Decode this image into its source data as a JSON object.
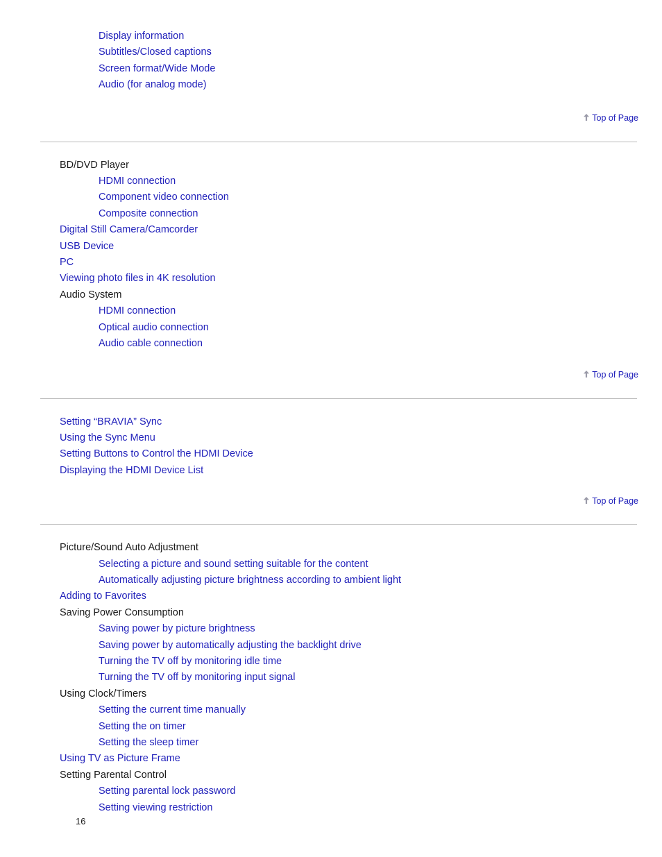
{
  "document": {
    "page_number": "16",
    "link_color": "#2222bb",
    "text_color": "#1a1a1a",
    "divider_color": "#b9b9b9"
  },
  "top_of_page": {
    "label": "Top of Page",
    "icon": "arrow-up-icon"
  },
  "sections": [
    {
      "id": "watching-tv",
      "has_divider_above": false,
      "items": [
        {
          "text": "Display information",
          "level": 2,
          "link": true
        },
        {
          "text": "Subtitles/Closed captions",
          "level": 2,
          "link": true
        },
        {
          "text": "Screen format/Wide Mode",
          "level": 2,
          "link": true
        },
        {
          "text": "Audio (for analog mode)",
          "level": 2,
          "link": true
        }
      ]
    },
    {
      "id": "connecting-devices",
      "has_divider_above": true,
      "items": [
        {
          "text": "BD/DVD Player",
          "level": 1,
          "link": false
        },
        {
          "text": "HDMI connection",
          "level": 2,
          "link": true
        },
        {
          "text": "Component video connection",
          "level": 2,
          "link": true
        },
        {
          "text": "Composite connection",
          "level": 2,
          "link": true
        },
        {
          "text": "Digital Still Camera/Camcorder",
          "level": 1,
          "link": true
        },
        {
          "text": "USB Device",
          "level": 1,
          "link": true
        },
        {
          "text": "PC",
          "level": 1,
          "link": true
        },
        {
          "text": "Viewing photo files in 4K resolution",
          "level": 1,
          "link": true
        },
        {
          "text": "Audio System",
          "level": 1,
          "link": false
        },
        {
          "text": "HDMI connection",
          "level": 2,
          "link": true
        },
        {
          "text": "Optical audio connection",
          "level": 2,
          "link": true
        },
        {
          "text": "Audio cable connection",
          "level": 2,
          "link": true
        }
      ]
    },
    {
      "id": "bravia-sync",
      "has_divider_above": true,
      "items": [
        {
          "text": "Setting “BRAVIA” Sync",
          "level": 1,
          "link": true
        },
        {
          "text": "Using the Sync Menu",
          "level": 1,
          "link": true
        },
        {
          "text": "Setting Buttons to Control the HDMI Device",
          "level": 1,
          "link": true
        },
        {
          "text": "Displaying the HDMI Device List",
          "level": 1,
          "link": true
        }
      ]
    },
    {
      "id": "using-preference-features",
      "has_divider_above": true,
      "items": [
        {
          "text": "Picture/Sound Auto Adjustment",
          "level": 1,
          "link": false
        },
        {
          "text": "Selecting a picture and sound setting suitable for the content",
          "level": 2,
          "link": true
        },
        {
          "text": "Automatically adjusting picture brightness according to ambient light",
          "level": 2,
          "link": true
        },
        {
          "text": "Adding to Favorites",
          "level": 1,
          "link": true
        },
        {
          "text": "Saving Power Consumption",
          "level": 1,
          "link": false
        },
        {
          "text": "Saving power by picture brightness",
          "level": 2,
          "link": true
        },
        {
          "text": "Saving power by automatically adjusting the backlight drive",
          "level": 2,
          "link": true
        },
        {
          "text": "Turning the TV off by monitoring idle time",
          "level": 2,
          "link": true
        },
        {
          "text": "Turning the TV off by monitoring input signal",
          "level": 2,
          "link": true
        },
        {
          "text": "Using Clock/Timers",
          "level": 1,
          "link": false
        },
        {
          "text": "Setting the current time manually",
          "level": 2,
          "link": true
        },
        {
          "text": "Setting the on timer",
          "level": 2,
          "link": true
        },
        {
          "text": "Setting the sleep timer",
          "level": 2,
          "link": true
        },
        {
          "text": "Using TV as Picture Frame",
          "level": 1,
          "link": true
        },
        {
          "text": "Setting Parental Control",
          "level": 1,
          "link": false
        },
        {
          "text": "Setting parental lock password",
          "level": 2,
          "link": true
        },
        {
          "text": "Setting viewing restriction",
          "level": 2,
          "link": true
        }
      ]
    }
  ]
}
